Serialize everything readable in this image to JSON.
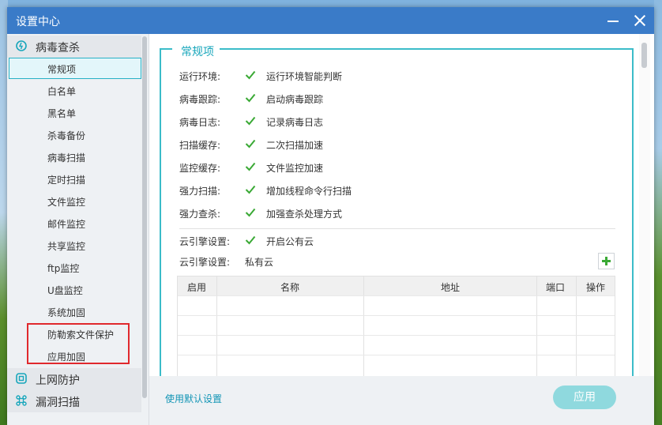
{
  "window": {
    "title": "设置中心"
  },
  "sidebar": {
    "groups": [
      {
        "label": "病毒查杀",
        "icon": "virus-scan-icon"
      },
      {
        "label": "上网防护",
        "icon": "web-protection-icon"
      },
      {
        "label": "漏洞扫描",
        "icon": "vulnerability-scan-icon"
      }
    ],
    "items": [
      {
        "label": "常规项",
        "active": true
      },
      {
        "label": "白名单"
      },
      {
        "label": "黑名单"
      },
      {
        "label": "杀毒备份"
      },
      {
        "label": "病毒扫描"
      },
      {
        "label": "定时扫描"
      },
      {
        "label": "文件监控"
      },
      {
        "label": "邮件监控"
      },
      {
        "label": "共享监控"
      },
      {
        "label": "ftp监控"
      },
      {
        "label": "U盘监控"
      },
      {
        "label": "系统加固"
      },
      {
        "label": "防勒索文件保护"
      },
      {
        "label": "应用加固"
      }
    ]
  },
  "section": {
    "title": "常规项",
    "rows": [
      {
        "label": "运行环境:",
        "option": "运行环境智能判断",
        "checked": true
      },
      {
        "label": "病毒跟踪:",
        "option": "启动病毒跟踪",
        "checked": true
      },
      {
        "label": "病毒日志:",
        "option": "记录病毒日志",
        "checked": true
      },
      {
        "label": "扫描缓存:",
        "option": "二次扫描加速",
        "checked": true
      },
      {
        "label": "监控缓存:",
        "option": "文件监控加速",
        "checked": true
      },
      {
        "label": "强力扫描:",
        "option": "增加线程命令行扫描",
        "checked": true
      },
      {
        "label": "强力查杀:",
        "option": "加强查杀处理方式",
        "checked": true
      }
    ],
    "cloud": {
      "public_label": "云引擎设置:",
      "public_option": "开启公有云",
      "public_checked": true,
      "private_label": "云引擎设置:",
      "private_value": "私有云"
    },
    "table": {
      "headers": [
        "启用",
        "名称",
        "地址",
        "端口",
        "操作"
      ],
      "rows": []
    }
  },
  "footer": {
    "default_link": "使用默认设置",
    "apply_label": "应用"
  },
  "colors": {
    "titlebar": "#3a7bc8",
    "accent": "#27b1c6",
    "check": "#3aa935",
    "apply_button": "#8fd9de",
    "highlight": "#e0292d"
  }
}
